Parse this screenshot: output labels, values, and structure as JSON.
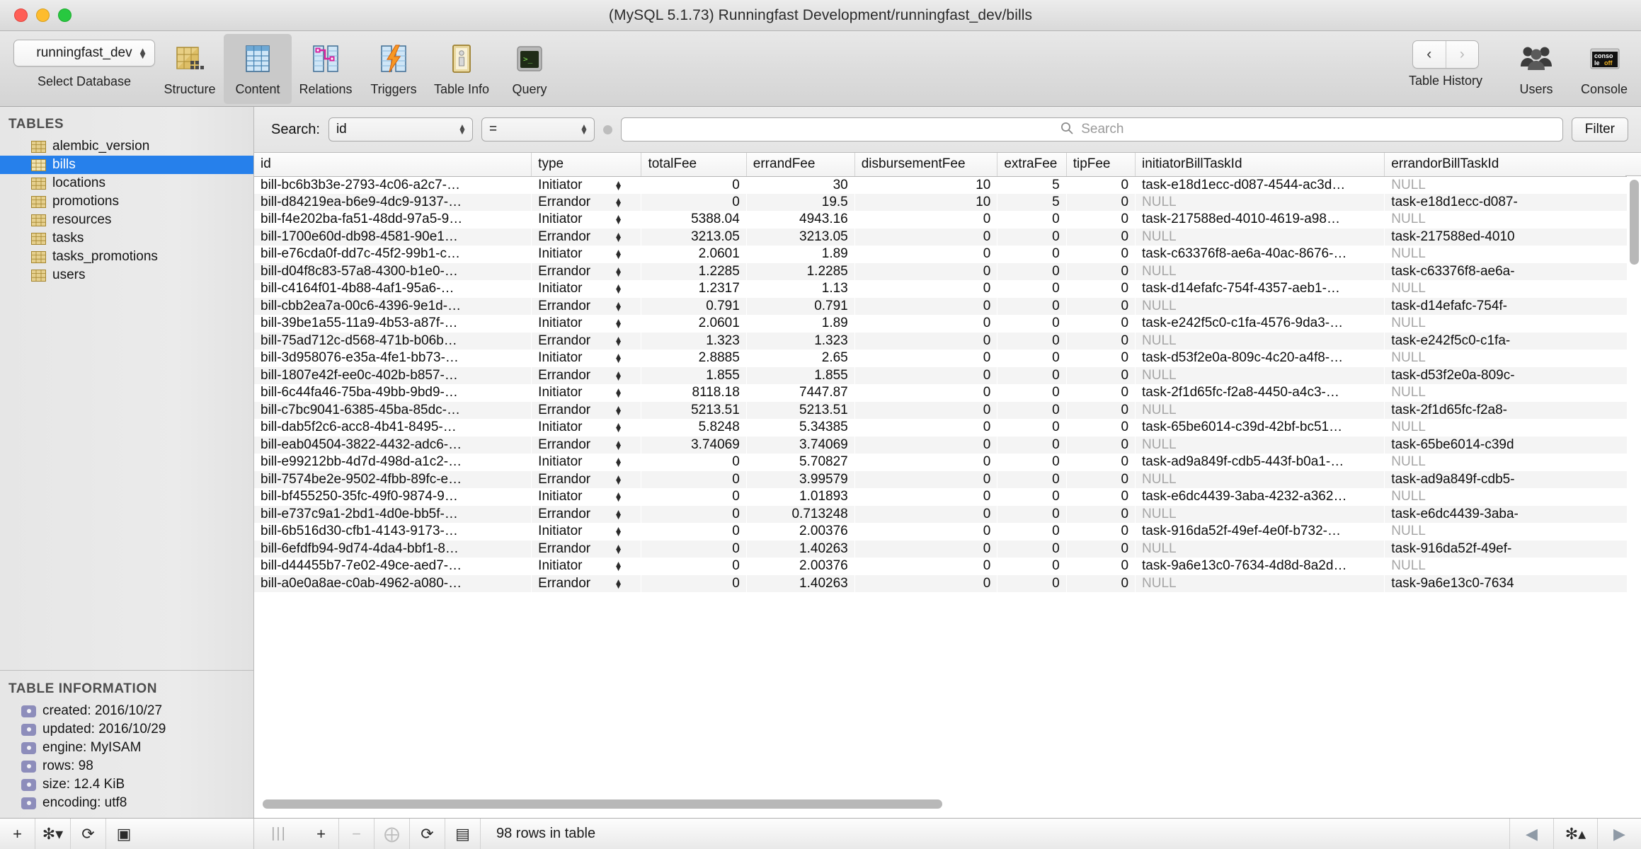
{
  "window": {
    "title": "(MySQL 5.1.73) Runningfast Development/runningfast_dev/bills",
    "traffic_lights": [
      "close",
      "minimize",
      "zoom"
    ]
  },
  "toolbar": {
    "database_select": {
      "value": "runningfast_dev",
      "caption": "Select Database"
    },
    "items": [
      {
        "id": "structure",
        "label": "Structure",
        "icon": "table-structure-icon",
        "active": false
      },
      {
        "id": "content",
        "label": "Content",
        "icon": "table-grid-icon",
        "active": true
      },
      {
        "id": "relations",
        "label": "Relations",
        "icon": "relations-icon",
        "active": false
      },
      {
        "id": "triggers",
        "label": "Triggers",
        "icon": "triggers-bolt-icon",
        "active": false
      },
      {
        "id": "tableinfo",
        "label": "Table Info",
        "icon": "info-icon",
        "active": false
      },
      {
        "id": "query",
        "label": "Query",
        "icon": "terminal-icon",
        "active": false
      }
    ],
    "table_history": {
      "label": "Table History",
      "back": "‹",
      "forward": "›"
    },
    "users": {
      "label": "Users",
      "icon": "users-icon"
    },
    "console": {
      "label": "Console",
      "icon": "console-off-icon",
      "badge_top": "conso",
      "badge_bottom_a": "le ",
      "badge_bottom_b": "off"
    }
  },
  "sidebar": {
    "tables_header": "TABLES",
    "tables": [
      {
        "name": "alembic_version",
        "selected": false
      },
      {
        "name": "bills",
        "selected": true
      },
      {
        "name": "locations",
        "selected": false
      },
      {
        "name": "promotions",
        "selected": false
      },
      {
        "name": "resources",
        "selected": false
      },
      {
        "name": "tasks",
        "selected": false
      },
      {
        "name": "tasks_promotions",
        "selected": false
      },
      {
        "name": "users",
        "selected": false
      }
    ],
    "info_header": "TABLE INFORMATION",
    "info": [
      "created: 2016/10/27",
      "updated: 2016/10/29",
      "engine: MyISAM",
      "rows: 98",
      "size: 12.4 KiB",
      "encoding: utf8"
    ],
    "selection_color": "#2680eb"
  },
  "filterbar": {
    "search_label": "Search:",
    "field_value": "id",
    "operator_value": "=",
    "search_placeholder": "Search",
    "search_value": "",
    "filter_button": "Filter"
  },
  "table": {
    "columns": [
      "id",
      "type",
      "totalFee",
      "errandFee",
      "disbursementFee",
      "extraFee",
      "tipFee",
      "initiatorBillTaskId",
      "errandorBillTaskId"
    ],
    "rows": [
      [
        "bill-bc6b3b3e-2793-4c06-a2c7-…",
        "Initiator",
        "0",
        "30",
        "10",
        "5",
        "0",
        "task-e18d1ecc-d087-4544-ac3d…",
        "NULL"
      ],
      [
        "bill-d84219ea-b6e9-4dc9-9137-…",
        "Errandor",
        "0",
        "19.5",
        "10",
        "5",
        "0",
        "NULL",
        "task-e18d1ecc-d087-"
      ],
      [
        "bill-f4e202ba-fa51-48dd-97a5-9…",
        "Initiator",
        "5388.04",
        "4943.16",
        "0",
        "0",
        "0",
        "task-217588ed-4010-4619-a98…",
        "NULL"
      ],
      [
        "bill-1700e60d-db98-4581-90e1…",
        "Errandor",
        "3213.05",
        "3213.05",
        "0",
        "0",
        "0",
        "NULL",
        "task-217588ed-4010"
      ],
      [
        "bill-e76cda0f-dd7c-45f2-99b1-c…",
        "Initiator",
        "2.0601",
        "1.89",
        "0",
        "0",
        "0",
        "task-c63376f8-ae6a-40ac-8676-…",
        "NULL"
      ],
      [
        "bill-d04f8c83-57a8-4300-b1e0-…",
        "Errandor",
        "1.2285",
        "1.2285",
        "0",
        "0",
        "0",
        "NULL",
        "task-c63376f8-ae6a-"
      ],
      [
        "bill-c4164f01-4b88-4af1-95a6-…",
        "Initiator",
        "1.2317",
        "1.13",
        "0",
        "0",
        "0",
        "task-d14efafc-754f-4357-aeb1-…",
        "NULL"
      ],
      [
        "bill-cbb2ea7a-00c6-4396-9e1d-…",
        "Errandor",
        "0.791",
        "0.791",
        "0",
        "0",
        "0",
        "NULL",
        "task-d14efafc-754f-"
      ],
      [
        "bill-39be1a55-11a9-4b53-a87f-…",
        "Initiator",
        "2.0601",
        "1.89",
        "0",
        "0",
        "0",
        "task-e242f5c0-c1fa-4576-9da3-…",
        "NULL"
      ],
      [
        "bill-75ad712c-d568-471b-b06b…",
        "Errandor",
        "1.323",
        "1.323",
        "0",
        "0",
        "0",
        "NULL",
        "task-e242f5c0-c1fa-"
      ],
      [
        "bill-3d958076-e35a-4fe1-bb73-…",
        "Initiator",
        "2.8885",
        "2.65",
        "0",
        "0",
        "0",
        "task-d53f2e0a-809c-4c20-a4f8-…",
        "NULL"
      ],
      [
        "bill-1807e42f-ee0c-402b-b857-…",
        "Errandor",
        "1.855",
        "1.855",
        "0",
        "0",
        "0",
        "NULL",
        "task-d53f2e0a-809c-"
      ],
      [
        "bill-6c44fa46-75ba-49bb-9bd9-…",
        "Initiator",
        "8118.18",
        "7447.87",
        "0",
        "0",
        "0",
        "task-2f1d65fc-f2a8-4450-a4c3-…",
        "NULL"
      ],
      [
        "bill-c7bc9041-6385-45ba-85dc-…",
        "Errandor",
        "5213.51",
        "5213.51",
        "0",
        "0",
        "0",
        "NULL",
        "task-2f1d65fc-f2a8-"
      ],
      [
        "bill-dab5f2c6-acc8-4b41-8495-…",
        "Initiator",
        "5.8248",
        "5.34385",
        "0",
        "0",
        "0",
        "task-65be6014-c39d-42bf-bc51…",
        "NULL"
      ],
      [
        "bill-eab04504-3822-4432-adc6-…",
        "Errandor",
        "3.74069",
        "3.74069",
        "0",
        "0",
        "0",
        "NULL",
        "task-65be6014-c39d"
      ],
      [
        "bill-e99212bb-4d7d-498d-a1c2-…",
        "Initiator",
        "0",
        "5.70827",
        "0",
        "0",
        "0",
        "task-ad9a849f-cdb5-443f-b0a1-…",
        "NULL"
      ],
      [
        "bill-7574be2e-9502-4fbb-89fc-e…",
        "Errandor",
        "0",
        "3.99579",
        "0",
        "0",
        "0",
        "NULL",
        "task-ad9a849f-cdb5-"
      ],
      [
        "bill-bf455250-35fc-49f0-9874-9…",
        "Initiator",
        "0",
        "1.01893",
        "0",
        "0",
        "0",
        "task-e6dc4439-3aba-4232-a362…",
        "NULL"
      ],
      [
        "bill-e737c9a1-2bd1-4d0e-bb5f-…",
        "Errandor",
        "0",
        "0.713248",
        "0",
        "0",
        "0",
        "NULL",
        "task-e6dc4439-3aba-"
      ],
      [
        "bill-6b516d30-cfb1-4143-9173-…",
        "Initiator",
        "0",
        "2.00376",
        "0",
        "0",
        "0",
        "task-916da52f-49ef-4e0f-b732-…",
        "NULL"
      ],
      [
        "bill-6efdfb94-9d74-4da4-bbf1-8…",
        "Errandor",
        "0",
        "1.40263",
        "0",
        "0",
        "0",
        "NULL",
        "task-916da52f-49ef-"
      ],
      [
        "bill-d44455b7-7e02-49ce-aed7-…",
        "Initiator",
        "0",
        "2.00376",
        "0",
        "0",
        "0",
        "task-9a6e13c0-7634-4d8d-8a2d…",
        "NULL"
      ],
      [
        "bill-a0e0a8ae-c0ab-4962-a080-…",
        "Errandor",
        "0",
        "1.40263",
        "0",
        "0",
        "0",
        "NULL",
        "task-9a6e13c0-7634"
      ]
    ]
  },
  "statusbar": {
    "left_buttons": [
      {
        "icon": "plus-icon",
        "label": "+"
      },
      {
        "icon": "gear-dropdown-icon",
        "label": "✻▾"
      },
      {
        "icon": "refresh-icon",
        "label": "⟳"
      },
      {
        "icon": "filter-dropdown-icon",
        "label": "▣"
      }
    ],
    "grid_handle_icon": "resize-grip-icon",
    "row_buttons": [
      {
        "icon": "add-row-icon",
        "label": "+"
      },
      {
        "icon": "remove-row-icon",
        "label": "−",
        "disabled": true
      },
      {
        "icon": "duplicate-row-icon",
        "label": "⨁",
        "disabled": true
      },
      {
        "icon": "reload-table-icon",
        "label": "⟳"
      },
      {
        "icon": "view-rows-icon",
        "label": "▤"
      }
    ],
    "rows_label": "98 rows in table",
    "pager": [
      {
        "icon": "previous-page-icon",
        "label": "◀"
      },
      {
        "icon": "gear-up-icon",
        "label": "✻▴"
      },
      {
        "icon": "next-page-icon",
        "label": "▶"
      }
    ]
  }
}
